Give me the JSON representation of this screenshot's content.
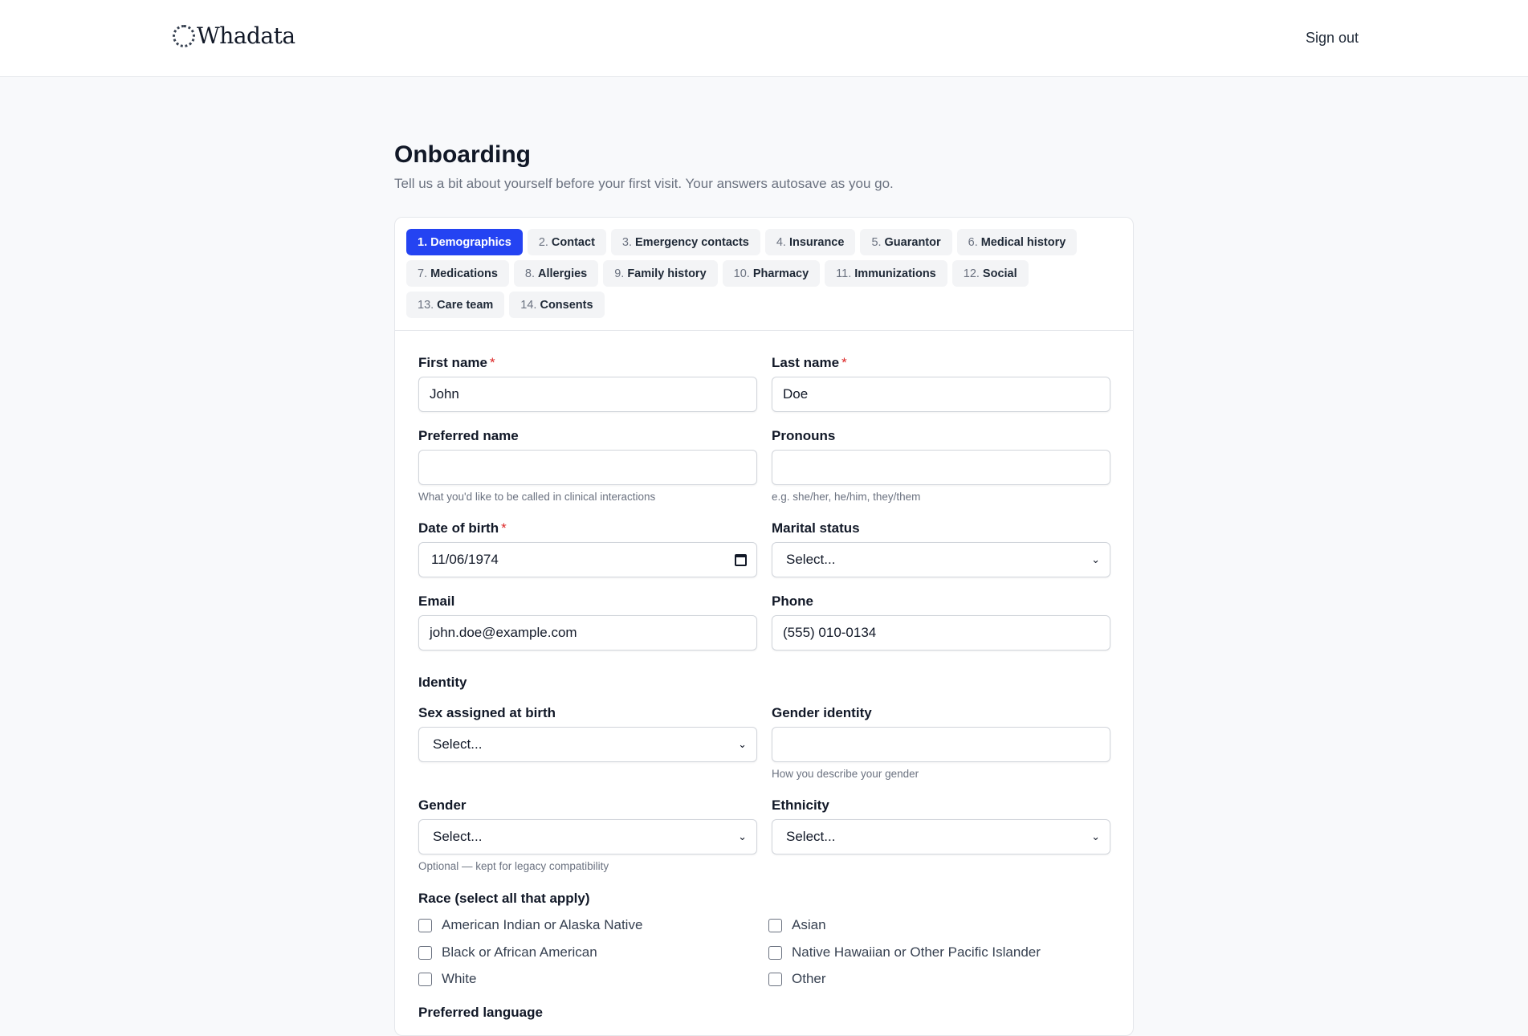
{
  "header": {
    "logo_text": "Whadata",
    "signout_label": "Sign out"
  },
  "page": {
    "title": "Onboarding",
    "subtitle": "Tell us a bit about yourself before your first visit. Your answers autosave as you go."
  },
  "tabs": [
    {
      "num": "1.",
      "label": "Demographics",
      "active": true
    },
    {
      "num": "2.",
      "label": "Contact"
    },
    {
      "num": "3.",
      "label": "Emergency contacts"
    },
    {
      "num": "4.",
      "label": "Insurance"
    },
    {
      "num": "5.",
      "label": "Guarantor"
    },
    {
      "num": "6.",
      "label": "Medical history"
    },
    {
      "num": "7.",
      "label": "Medications"
    },
    {
      "num": "8.",
      "label": "Allergies"
    },
    {
      "num": "9.",
      "label": "Family history"
    },
    {
      "num": "10.",
      "label": "Pharmacy"
    },
    {
      "num": "11.",
      "label": "Immunizations"
    },
    {
      "num": "12.",
      "label": "Social"
    },
    {
      "num": "13.",
      "label": "Care team"
    },
    {
      "num": "14.",
      "label": "Consents"
    }
  ],
  "form": {
    "first_name": {
      "label": "First name",
      "value": "John"
    },
    "last_name": {
      "label": "Last name",
      "value": "Doe"
    },
    "preferred_name": {
      "label": "Preferred name",
      "value": "",
      "hint": "What you'd like to be called in clinical interactions"
    },
    "pronouns": {
      "label": "Pronouns",
      "value": "",
      "hint": "e.g. she/her, he/him, they/them"
    },
    "dob": {
      "label": "Date of birth",
      "value": "11/06/1974"
    },
    "marital": {
      "label": "Marital status",
      "value": "Select..."
    },
    "email": {
      "label": "Email",
      "value": "john.doe@example.com"
    },
    "phone": {
      "label": "Phone",
      "value": "(555) 010-0134"
    },
    "identity_title": "Identity",
    "sex_at_birth": {
      "label": "Sex assigned at birth",
      "value": "Select..."
    },
    "gender_identity": {
      "label": "Gender identity",
      "value": "",
      "hint": "How you describe your gender"
    },
    "gender": {
      "label": "Gender",
      "value": "Select...",
      "hint": "Optional — kept for legacy compatibility"
    },
    "ethnicity": {
      "label": "Ethnicity",
      "value": "Select..."
    },
    "race": {
      "label": "Race (select all that apply)",
      "options": [
        "American Indian or Alaska Native",
        "Asian",
        "Black or African American",
        "Native Hawaiian or Other Pacific Islander",
        "White",
        "Other"
      ]
    },
    "preferred_language": {
      "label": "Preferred language"
    }
  }
}
